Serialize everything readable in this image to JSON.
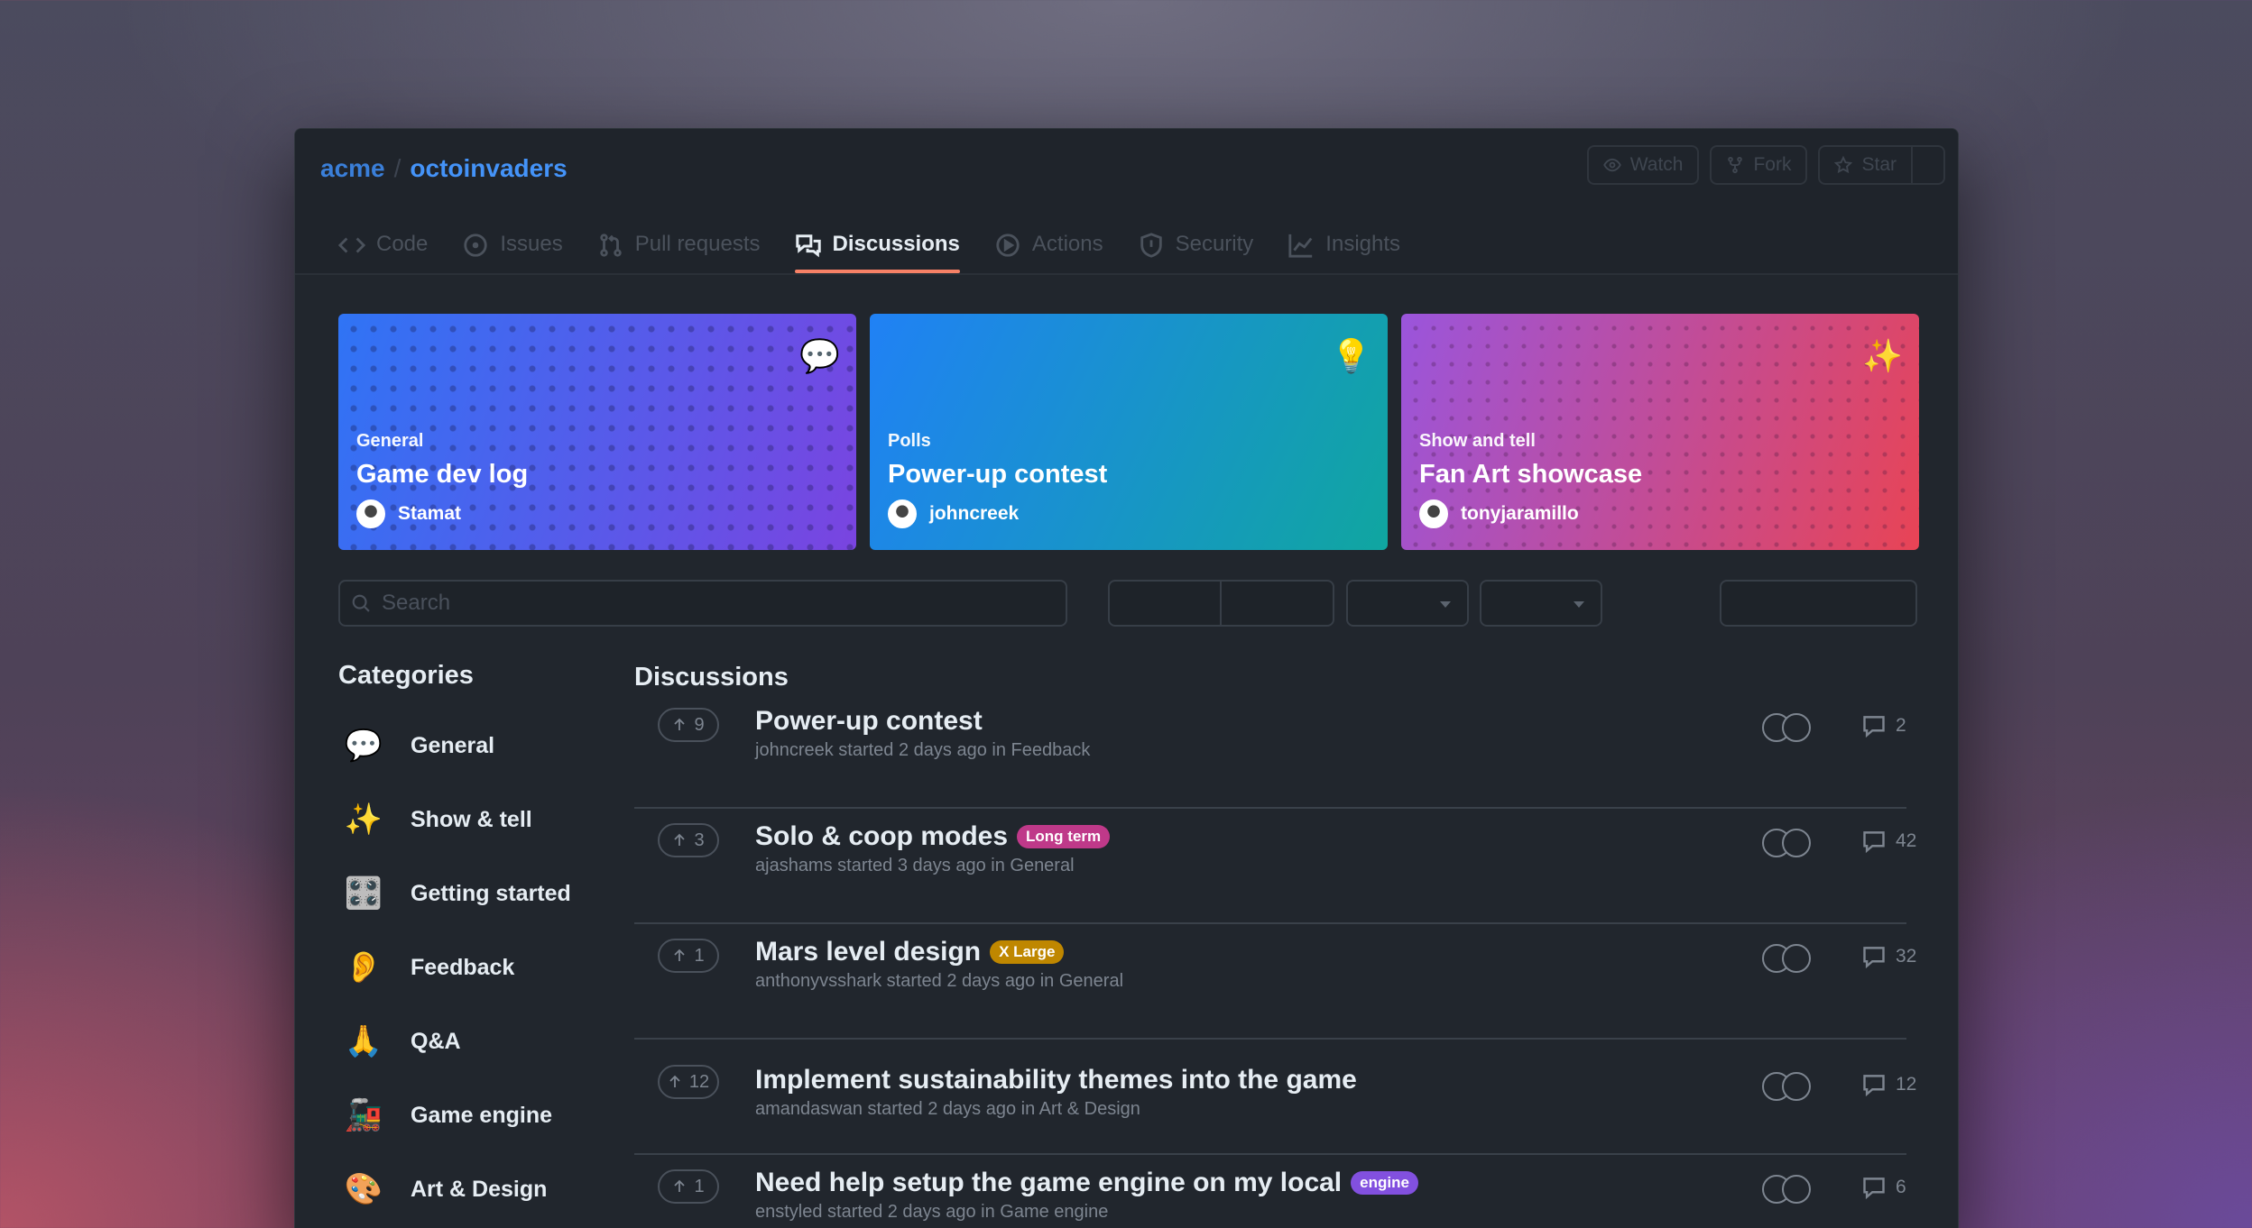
{
  "repo": {
    "owner": "acme",
    "separator": "/",
    "name": "octoinvaders"
  },
  "repo_actions": {
    "watch": "Watch",
    "fork": "Fork",
    "star": "Star"
  },
  "tabs": [
    {
      "label": "Code",
      "icon": "code-icon"
    },
    {
      "label": "Issues",
      "icon": "issue-icon"
    },
    {
      "label": "Pull requests",
      "icon": "pull-request-icon"
    },
    {
      "label": "Discussions",
      "icon": "discussion-icon",
      "active": true
    },
    {
      "label": "Actions",
      "icon": "play-icon"
    },
    {
      "label": "Security",
      "icon": "shield-icon"
    },
    {
      "label": "Insights",
      "icon": "graph-icon"
    }
  ],
  "featured": [
    {
      "category": "General",
      "title": "Game dev log",
      "author": "Stamat",
      "emoji": "💬"
    },
    {
      "category": "Polls",
      "title": "Power-up contest",
      "author": "johncreek",
      "emoji": "💡"
    },
    {
      "category": "Show and tell",
      "title": "Fan Art showcase",
      "author": "tonyjaramillo",
      "emoji": "✨"
    }
  ],
  "search": {
    "placeholder": "Search"
  },
  "sidebar": {
    "heading": "Categories",
    "items": [
      {
        "emoji": "💬",
        "label": "General"
      },
      {
        "emoji": "✨",
        "label": "Show & tell"
      },
      {
        "emoji": "🎛️",
        "label": "Getting started"
      },
      {
        "emoji": "👂",
        "label": "Feedback"
      },
      {
        "emoji": "🙏",
        "label": "Q&A"
      },
      {
        "emoji": "🚂",
        "label": "Game engine"
      },
      {
        "emoji": "🎨",
        "label": "Art & Design"
      }
    ]
  },
  "discussions": {
    "heading": "Discussions",
    "rows": [
      {
        "votes": "9",
        "title": "Power-up contest",
        "label": "",
        "meta": "johncreek started 2 days ago in Feedback",
        "comments": "2"
      },
      {
        "votes": "3",
        "title": "Solo & coop modes",
        "label": "Long term",
        "label_color": "#bf3989",
        "meta": "ajashams started 3 days ago in General",
        "comments": "42"
      },
      {
        "votes": "1",
        "title": "Mars level design",
        "label": "X Large",
        "label_color": "#bf8700",
        "meta": "anthonyvsshark started 2 days ago in General",
        "comments": "32"
      },
      {
        "votes": "12",
        "title": "Implement sustainability themes into the game",
        "label": "",
        "meta": "amandaswan started 2 days ago in Art & Design",
        "comments": "12"
      },
      {
        "votes": "1",
        "title": "Need help setup the game engine on my local",
        "label": "engine",
        "label_color": "#8250df",
        "meta": "enstyled started 2 days ago in Game engine",
        "comments": "6"
      }
    ]
  }
}
